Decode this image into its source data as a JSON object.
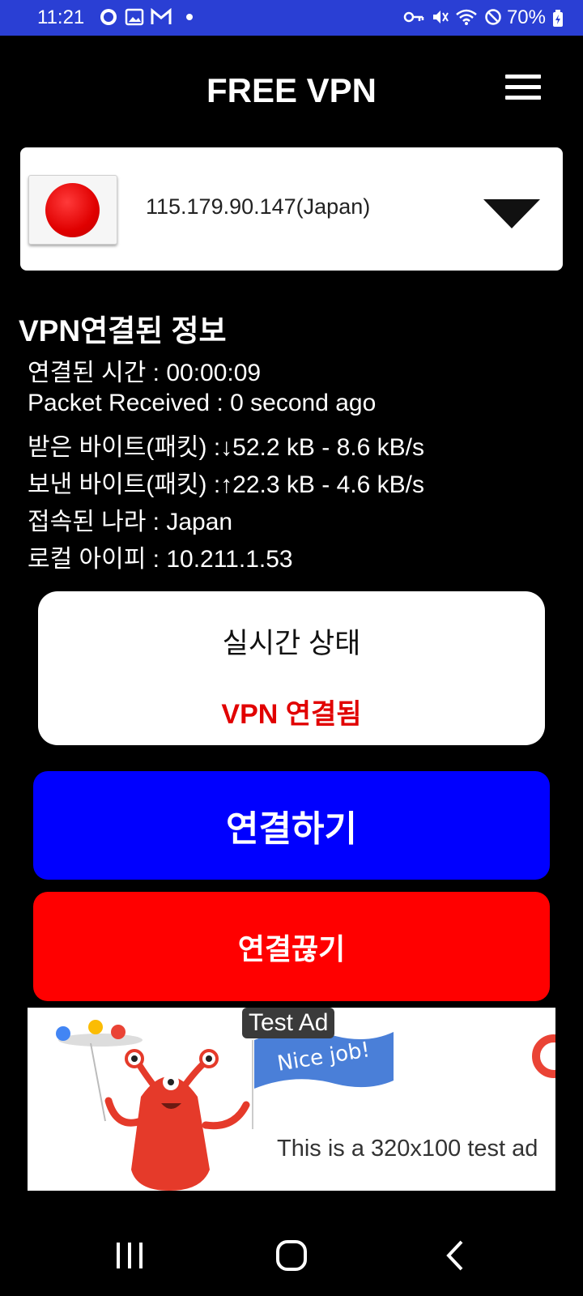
{
  "status_bar": {
    "time": "11:21",
    "battery": "70%",
    "left_icons": [
      "talk-notification-icon",
      "gallery-icon",
      "gmail-icon",
      "dot-icon"
    ],
    "right_icons": [
      "vpn-key-icon",
      "mute-icon",
      "wifi-icon",
      "do-not-disturb-icon",
      "battery-charging-icon"
    ]
  },
  "header": {
    "title": "FREE VPN",
    "menu_icon": "hamburger-menu-icon"
  },
  "server": {
    "label": "115.179.90.147(Japan)",
    "flag": "japan-flag-icon",
    "flag_color": "#e00000"
  },
  "info": {
    "title": "VPN연결된 정보",
    "lines": [
      "연결된 시간 : 00:00:09",
      "Packet Received : 0 second ago",
      "받은 바이트(패킷) :↓52.2 kB - 8.6 kB/s",
      "보낸 바이트(패킷) :↑22.3 kB - 4.6 kB/s",
      "접속된 나라 : Japan",
      "로컬 아이피 : 10.211.1.53"
    ]
  },
  "status": {
    "heading": "실시간 상태",
    "value": "VPN 연결됨",
    "value_color": "#e10000"
  },
  "buttons": {
    "connect": "연결하기",
    "connect_color": "#0000ff",
    "disconnect": "연결끊기",
    "disconnect_color": "#ff0000"
  },
  "ad": {
    "badge": "Test Ad",
    "flag_text": "Nice job!",
    "text": "This is a 320x100 test ad"
  },
  "nav": {
    "icons": [
      "recent-apps-icon",
      "home-icon",
      "back-icon"
    ]
  }
}
